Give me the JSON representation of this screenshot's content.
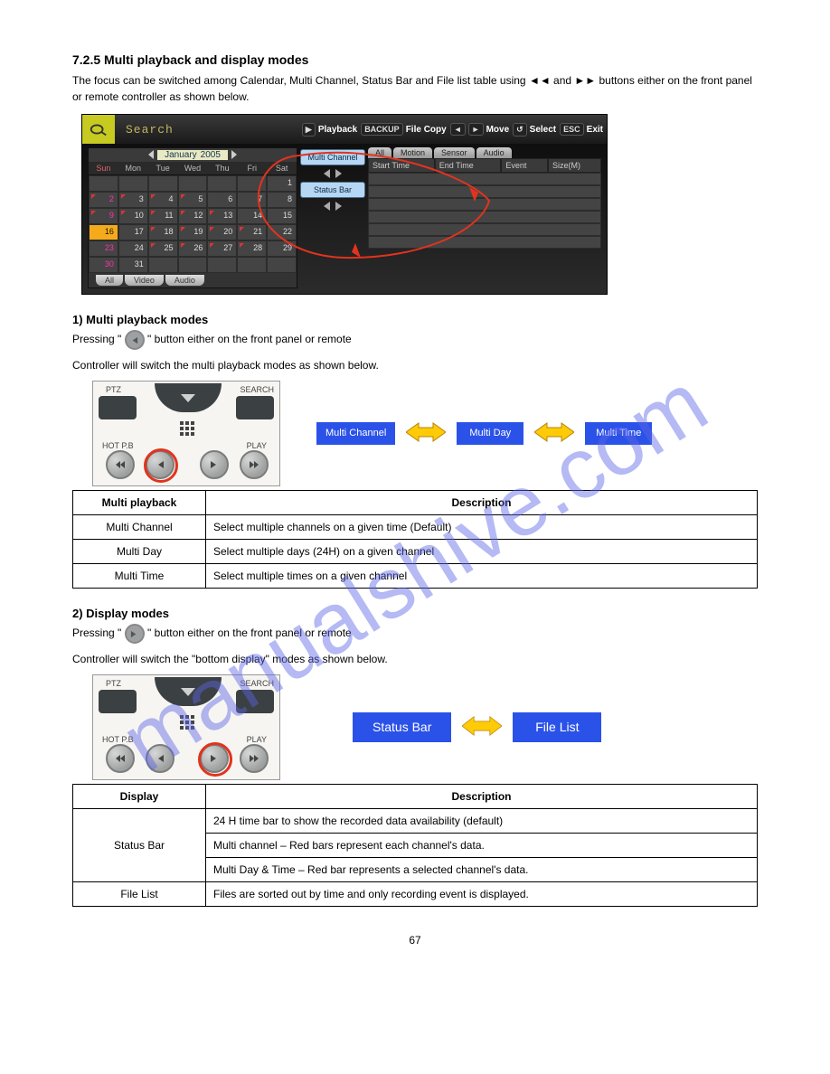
{
  "watermark": "manualshive.com",
  "page_number": "67",
  "section": {
    "header": "7.2.5 Multi playback and display modes",
    "intro": "The focus can be switched among Calendar, Multi Channel, Status Bar and File list table using ◄◄ and ►► buttons either on the front panel or remote controller as shown below."
  },
  "dvr": {
    "search_label": "Search",
    "tools": {
      "playback": "Playback",
      "backup": "BACKUP",
      "filecopy": "File Copy",
      "move": "Move",
      "select": "Select",
      "esc": "ESC",
      "exit": "Exit"
    },
    "calendar": {
      "month": "January",
      "year": "2005",
      "dow": [
        "Sun",
        "Mon",
        "Tue",
        "Wed",
        "Thu",
        "Fri",
        "Sat"
      ],
      "rows": [
        [
          "",
          "",
          "",
          "",
          "",
          "",
          "1"
        ],
        [
          "2",
          "3",
          "4",
          "5",
          "6",
          "7",
          "8"
        ],
        [
          "9",
          "10",
          "11",
          "12",
          "13",
          "14",
          "15"
        ],
        [
          "16",
          "17",
          "18",
          "19",
          "20",
          "21",
          "22"
        ],
        [
          "23",
          "24",
          "25",
          "26",
          "27",
          "28",
          "29"
        ],
        [
          "30",
          "31",
          "",
          "",
          "",
          "",
          ""
        ]
      ],
      "tabs": [
        "All",
        "Video",
        "Audio"
      ]
    },
    "center": {
      "multi_channel": "Multi Channel",
      "status_bar": "Status Bar"
    },
    "event_tabs": [
      "All",
      "Motion",
      "Sensor",
      "Audio"
    ],
    "event_cols": [
      "Start Time",
      "End Time",
      "Event",
      "Size(M)"
    ]
  },
  "multi_play": {
    "heading": "1) Multi playback modes",
    "para1_a": "Pressing \"",
    "para1_b": "\" button either on the front panel or remote",
    "para2": "Controller will switch the multi playback modes as shown below.",
    "remote_labels": {
      "ptz": "PTZ",
      "search": "SEARCH",
      "hotpb": "HOT P.B",
      "play": "PLAY"
    },
    "diagram": {
      "b1": "Multi Channel",
      "b2": "Multi Day",
      "b3": "Multi Time"
    },
    "table": {
      "head": [
        "Multi playback",
        "Description"
      ],
      "rows": [
        [
          "Multi Channel",
          "Select multiple channels on a given time (Default)"
        ],
        [
          "Multi Day",
          "Select multiple days (24H) on a given channel"
        ],
        [
          "Multi Time",
          "Select multiple times on a given channel"
        ]
      ]
    }
  },
  "display": {
    "heading": "2) Display modes",
    "para1_a": "Pressing \"",
    "para1_b": "\" button either on the front panel or remote",
    "para2": "Controller will switch the \"bottom display\" modes as shown below.",
    "remote_labels": {
      "ptz": "PTZ",
      "search": "SEARCH",
      "hotpb": "HOT P.B",
      "play": "PLAY"
    },
    "diagram": {
      "b1": "Status Bar",
      "b2": "File List"
    },
    "table": {
      "head": [
        "Display",
        "Description"
      ],
      "row_status": [
        "Status Bar",
        "24 H time bar to show the recorded data availability (default)"
      ],
      "row_multi_ch": [
        "Multi channel",
        "Red bars represent each channel's data."
      ],
      "row_multi_dt": [
        "Multi Day & Time",
        "Red bar represents a selected channel's data."
      ],
      "row_filelist": [
        "File List",
        "Files are sorted out by time and only recording event is displayed."
      ]
    }
  }
}
